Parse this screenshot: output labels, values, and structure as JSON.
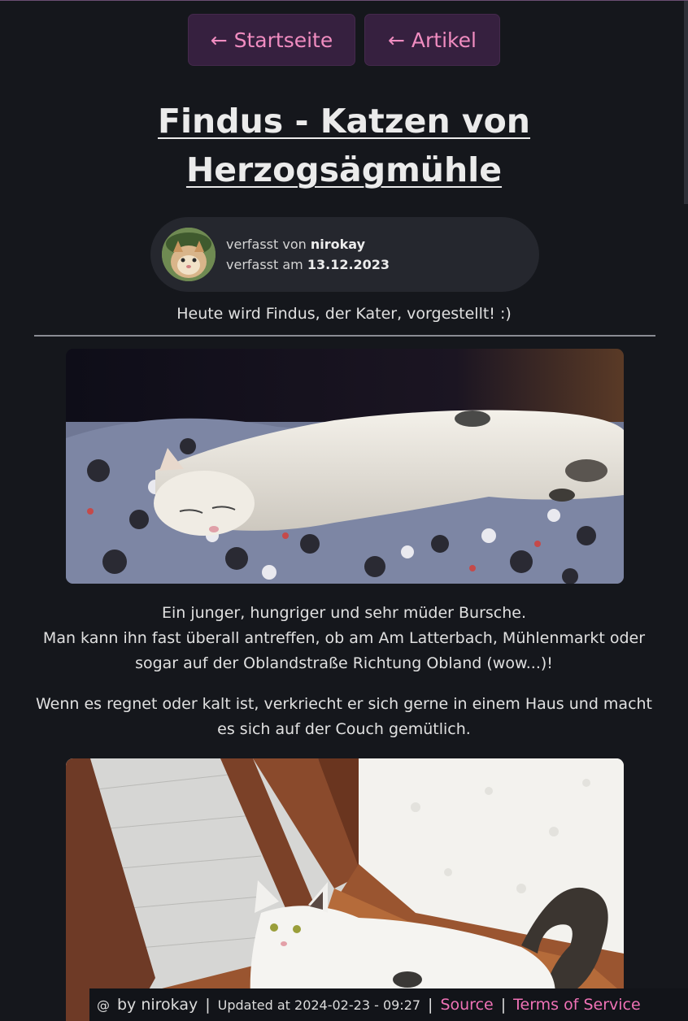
{
  "nav": {
    "home_label": "← Startseite",
    "articles_label": "← Artikel"
  },
  "article": {
    "title": "Findus - Katzen von Herzogsägmühle",
    "author_prefix": "verfasst von",
    "author_name": "nirokay",
    "date_prefix": "verfasst am",
    "date": "13.12.2023",
    "intro": "Heute wird Findus, der Kater, vorgestellt! :)",
    "paragraph1": [
      "Ein junger, hungriger und sehr müder Bursche.",
      "Man kann ihn fast überall antreffen, ob am Am Latterbach, Mühlenmarkt oder sogar auf der Oblandstraße Richtung Obland (wow...)!"
    ],
    "paragraph2": "Wenn es regnet oder kalt ist, verkriecht er sich gerne in einem Haus und macht es sich auf der Couch gemütlich."
  },
  "footer": {
    "spiral_icon": "spiral-icon",
    "by_text": "by nirokay",
    "sep": "|",
    "updated_text": "Updated at 2024-02-23 - 09:27",
    "source_label": "Source",
    "tos_label": "Terms of Service"
  },
  "colors": {
    "background": "#15171c",
    "button_bg": "#36203f",
    "accent_pink": "#f072b6",
    "card_bg": "#25272e"
  }
}
